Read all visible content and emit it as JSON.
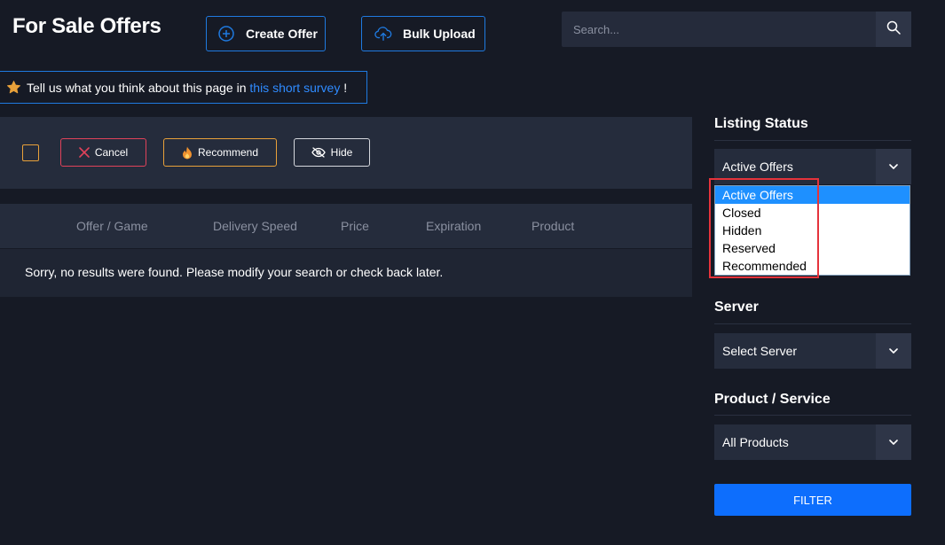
{
  "header": {
    "title": "For Sale Offers",
    "create_label": "Create Offer",
    "upload_label": "Bulk Upload",
    "search_placeholder": "Search..."
  },
  "survey": {
    "prefix": "Tell us what you think about this page in",
    "link": "this short survey",
    "suffix": "!"
  },
  "actions": {
    "cancel": "Cancel",
    "recommend": "Recommend",
    "hide": "Hide"
  },
  "table": {
    "columns": [
      "Offer / Game",
      "Delivery Speed",
      "Price",
      "Expiration",
      "Product"
    ],
    "empty_message": "Sorry, no results were found. Please modify your search or check back later."
  },
  "sidebar": {
    "listing_status": {
      "title": "Listing Status",
      "selected": "Active Offers",
      "options": [
        "Active Offers",
        "Closed",
        "Hidden",
        "Reserved",
        "Recommended"
      ]
    },
    "server": {
      "title": "Server",
      "selected": "Select Server"
    },
    "product": {
      "title": "Product / Service",
      "selected": "All Products"
    },
    "filter_label": "FILTER"
  },
  "colors": {
    "background": "#161a25",
    "panel": "#252c3c",
    "accent_blue": "#1f7ae0",
    "filter_blue": "#0d6efd",
    "cancel_red": "#e0425a",
    "recommend_orange": "#e8a13a",
    "highlight_red": "#e5333b"
  },
  "icons": {
    "create": "plus-circle-icon",
    "upload": "cloud-upload-icon",
    "search": "search-icon",
    "survey": "star-icon",
    "cancel": "x-icon",
    "recommend": "flame-icon",
    "hide": "eye-slash-icon",
    "dropdown": "chevron-down-icon"
  }
}
